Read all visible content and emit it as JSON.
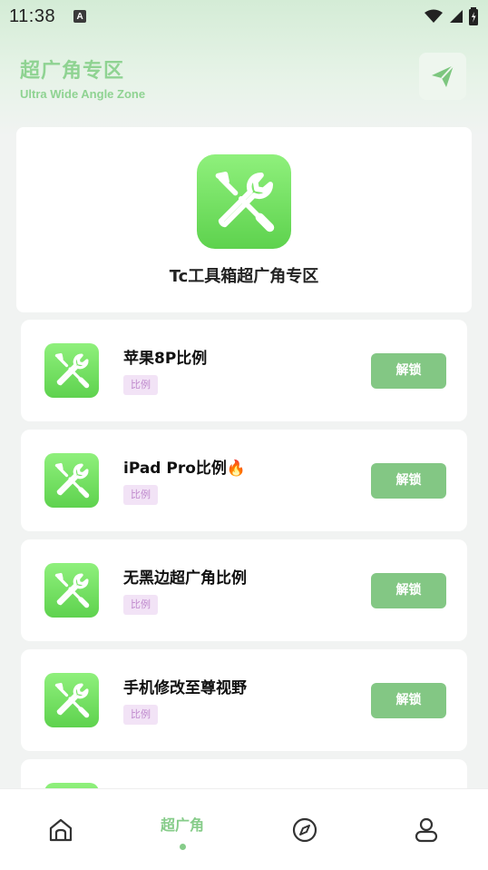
{
  "status_bar": {
    "time": "11:38",
    "notification_badge": "A",
    "icons": [
      "wifi-icon",
      "signal-icon",
      "battery-icon"
    ]
  },
  "header": {
    "title": "超广角专区",
    "subtitle": "Ultra Wide Angle Zone",
    "action_icon": "send-icon"
  },
  "feature": {
    "icon": "tools-icon",
    "title": "Tc工具箱超广角专区"
  },
  "items": [
    {
      "name": "苹果8P比例",
      "tag": "比例",
      "button": "解锁",
      "icon": "tools-icon"
    },
    {
      "name": "iPad Pro比例",
      "emoji": "🔥",
      "tag": "比例",
      "button": "解锁",
      "icon": "tools-icon"
    },
    {
      "name": "无黑边超广角比例",
      "tag": "比例",
      "button": "解锁",
      "icon": "tools-icon"
    },
    {
      "name": "手机修改至尊视野",
      "tag": "比例",
      "button": "解锁",
      "icon": "tools-icon"
    }
  ],
  "bottom_nav": {
    "items": [
      {
        "icon": "home-icon",
        "label": ""
      },
      {
        "icon": "",
        "label": "超广角",
        "active": true
      },
      {
        "icon": "compass-icon",
        "label": ""
      },
      {
        "icon": "user-icon",
        "label": ""
      }
    ]
  },
  "colors": {
    "accent": "#86cc89",
    "unlock_button": "#83c784",
    "tag_bg": "#f2e3f6",
    "tag_text": "#c08ace",
    "icon_green": "#6fe05c"
  }
}
